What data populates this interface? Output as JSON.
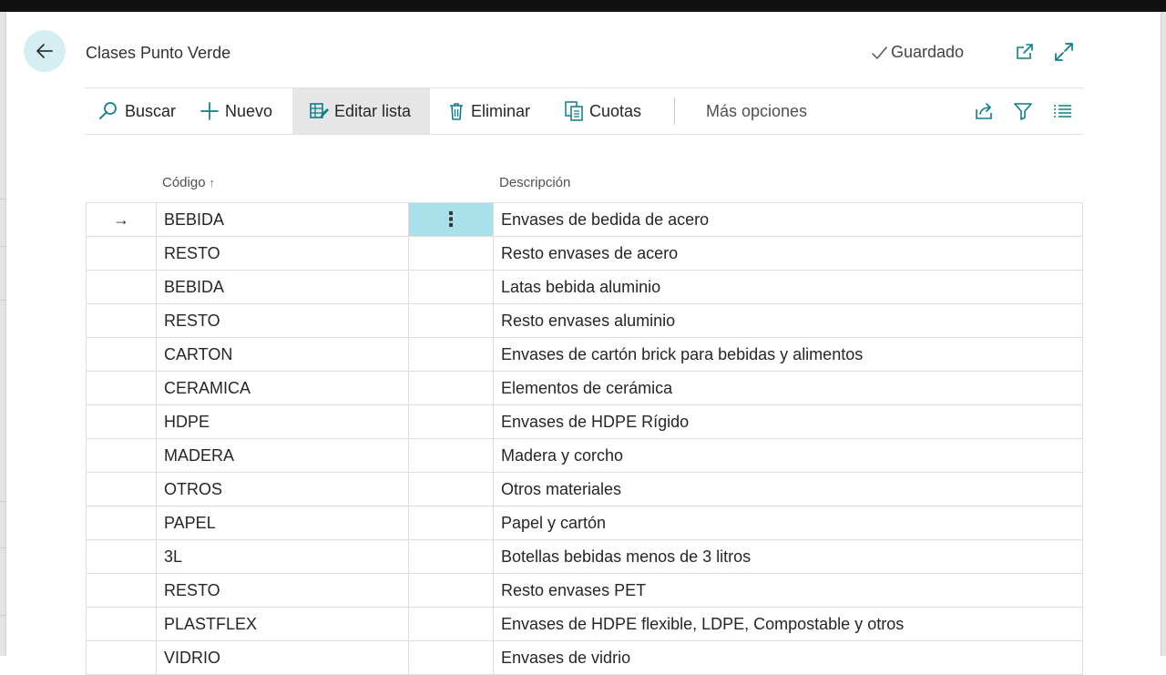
{
  "header": {
    "title": "Clases Punto Verde",
    "saved_label": "Guardado"
  },
  "toolbar": {
    "search_label": "Buscar",
    "new_label": "Nuevo",
    "edit_list_label": "Editar lista",
    "delete_label": "Eliminar",
    "fees_label": "Cuotas",
    "more_label": "Más opciones"
  },
  "table": {
    "columns": {
      "code": "Código",
      "description": "Descripción"
    },
    "sort_indicator": "↑",
    "current_row_marker": "→",
    "row_menu_glyph": "⋮",
    "rows": [
      {
        "code": "BEBIDA",
        "description": "Envases de bedida de acero"
      },
      {
        "code": "RESTO",
        "description": "Resto envases de acero"
      },
      {
        "code": "BEBIDA",
        "description": "Latas bebida aluminio"
      },
      {
        "code": "RESTO",
        "description": "Resto envases aluminio"
      },
      {
        "code": "CARTON",
        "description": "Envases de cartón brick para bebidas y alimentos"
      },
      {
        "code": "CERAMICA",
        "description": "Elementos de cerámica"
      },
      {
        "code": "HDPE",
        "description": "Envases de HDPE Rígido"
      },
      {
        "code": "MADERA",
        "description": "Madera y corcho"
      },
      {
        "code": "OTROS",
        "description": "Otros materiales"
      },
      {
        "code": "PAPEL",
        "description": "Papel y cartón"
      },
      {
        "code": "3L",
        "description": "Botellas bebidas menos de 3 litros"
      },
      {
        "code": "RESTO",
        "description": "Resto envases PET"
      },
      {
        "code": "PLASTFLEX",
        "description": "Envases de HDPE flexible, LDPE, Compostable y otros"
      },
      {
        "code": "VIDRIO",
        "description": "Envases de vidrio"
      }
    ]
  },
  "colors": {
    "accent": "#0b7d8a",
    "selected_cell": "#a9e0e9",
    "back_button_bg": "#d4eef2"
  }
}
